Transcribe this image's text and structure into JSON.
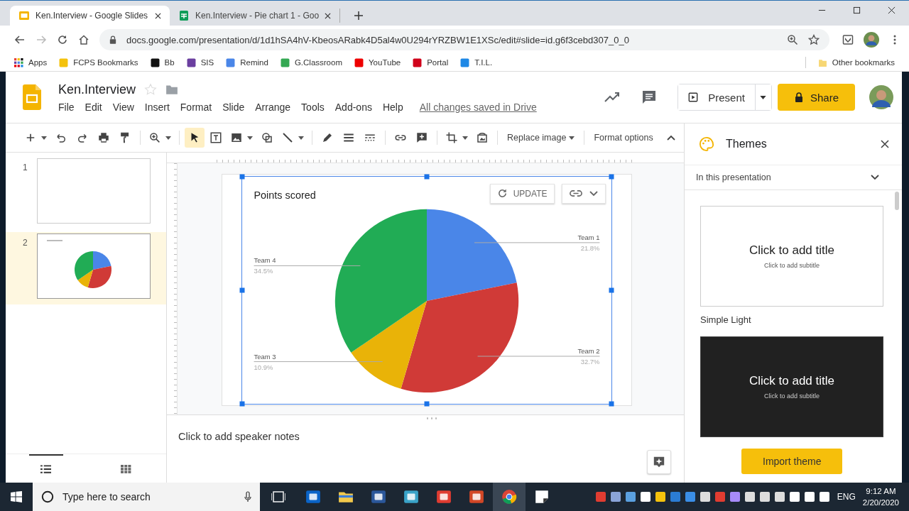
{
  "browser": {
    "tabs": [
      {
        "title": "Ken.Interview - Google Slides",
        "kind": "slides",
        "selected": true
      },
      {
        "title": "Ken.Interview - Pie chart 1 - Goo",
        "kind": "sheets",
        "selected": false
      }
    ],
    "url": "docs.google.com/presentation/d/1d1hSA4hV-KbeosARabk4D5al4w0U294rYRZBW1E1XSc/edit#slide=id.g6f3cebd307_0_0",
    "bookmarks": [
      {
        "label": "Apps"
      },
      {
        "label": "FCPS Bookmarks"
      },
      {
        "label": "Bb"
      },
      {
        "label": "SIS"
      },
      {
        "label": "Remind"
      },
      {
        "label": "G.Classroom"
      },
      {
        "label": "YouTube"
      },
      {
        "label": "Portal"
      },
      {
        "label": "T.I.L."
      }
    ],
    "other_bookmarks": "Other bookmarks"
  },
  "docs": {
    "title": "Ken.Interview",
    "menu": [
      "File",
      "Edit",
      "View",
      "Insert",
      "Format",
      "Slide",
      "Arrange",
      "Tools",
      "Add-ons",
      "Help"
    ],
    "save_status": "All changes saved in Drive",
    "present": "Present",
    "share": "Share"
  },
  "toolbar": {
    "tools": [
      {
        "kind": "new",
        "selected": false
      },
      {
        "kind": "undo",
        "selected": false
      },
      {
        "kind": "redo",
        "selected": false
      },
      {
        "kind": "print",
        "selected": false
      },
      {
        "kind": "paint",
        "selected": false
      },
      {
        "kind": "zoom",
        "selected": false
      },
      {
        "kind": "select",
        "selected": true
      },
      {
        "kind": "textbox",
        "selected": false
      },
      {
        "kind": "image",
        "selected": false
      },
      {
        "kind": "shape",
        "selected": false
      },
      {
        "kind": "line",
        "selected": false
      },
      {
        "kind": "pen",
        "selected": false
      },
      {
        "kind": "weight",
        "selected": false
      },
      {
        "kind": "dash",
        "selected": false
      },
      {
        "kind": "link",
        "selected": false
      },
      {
        "kind": "comment",
        "selected": false
      },
      {
        "kind": "crop",
        "selected": false
      },
      {
        "kind": "reset",
        "selected": false
      }
    ],
    "replace_image": "Replace image",
    "format_options": "Format options"
  },
  "filmstrip": {
    "slides": [
      {
        "number": "1",
        "selected": false
      },
      {
        "number": "2",
        "selected": true
      }
    ],
    "view_modes": [
      {
        "kind": "list",
        "selected": true
      },
      {
        "kind": "grid",
        "selected": false
      }
    ]
  },
  "slide": {
    "chart": {
      "update": "UPDATE",
      "chart_data": {
        "type": "pie",
        "title": "Points scored",
        "categories": [
          "Team 1",
          "Team 2",
          "Team 3",
          "Team 4"
        ],
        "values": [
          21.8,
          32.7,
          10.9,
          34.5
        ],
        "colors": [
          "#4a86e8",
          "#d03a37",
          "#e9b308",
          "#21ac55"
        ],
        "value_labels": [
          "21.8%",
          "32.7%",
          "10.9%",
          "34.5%"
        ]
      }
    }
  },
  "speaker_notes": {
    "placeholder": "Click to add speaker notes"
  },
  "themes": {
    "title": "Themes",
    "filter": "In this presentation",
    "items": [
      {
        "kind": "light",
        "name": "Simple Light",
        "title": "Click to add title",
        "subtitle": "Click to add subtitle"
      },
      {
        "kind": "dark",
        "title": "Click to add title",
        "subtitle": "Click to add subtitle"
      }
    ],
    "import": "Import theme"
  },
  "taskbar": {
    "search": {
      "placeholder": "Type here to search"
    },
    "apps": [
      {
        "kind": "outlook",
        "selected": false
      },
      {
        "kind": "files",
        "selected": false
      },
      {
        "kind": "word",
        "selected": false
      },
      {
        "kind": "note",
        "selected": false
      },
      {
        "kind": "snagit",
        "selected": false
      },
      {
        "kind": "powerpoint",
        "selected": false
      },
      {
        "kind": "chrome",
        "selected": true
      },
      {
        "kind": "sticky",
        "selected": false
      }
    ],
    "language": "ENG",
    "time": "9:12 AM",
    "date": "2/20/2020"
  }
}
